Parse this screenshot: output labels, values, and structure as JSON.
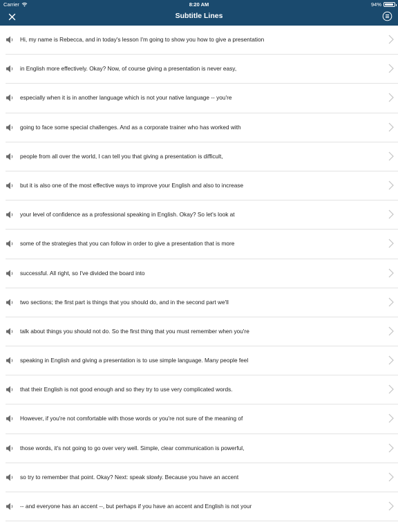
{
  "status_bar": {
    "carrier": "Carrier",
    "time": "8:20 AM",
    "battery": "94%",
    "battery_level": 0.94
  },
  "header": {
    "title": "Subtitle Lines"
  },
  "colors": {
    "header_bg": "#1a4a6e",
    "icon_gray": "#6b6b6b",
    "chevron": "#c4c4c4",
    "divider": "#e3e3e3"
  },
  "icons": {
    "close": "close-icon",
    "menu": "list-menu-icon",
    "speaker": "speaker-icon",
    "chevron": "chevron-right-icon"
  },
  "lines": [
    "Hi, my name is Rebecca, and in today's lesson I'm going to show you how to give a presentation",
    "in English more effectively. Okay? Now, of course giving a presentation is never easy,",
    "especially when it is in another language which is not your native language -- you're",
    "going to face some special challenges. And as a corporate trainer who has worked with",
    "people from all over the world, I can tell you that giving a presentation is difficult,",
    "but it is also one of the most effective ways to improve your English and also to increase",
    "your level of confidence as a professional speaking in English. Okay? So let's look at",
    "some of the strategies that you can follow in order to give a presentation that is more",
    "successful. All right, so I've divided the board into",
    "two sections; the first part is things that you should do, and in the second part we'll",
    "talk about things you should not do. So the first thing that you must remember when you're",
    "speaking in English and giving a presentation is to use simple language. Many people feel",
    "that their English is not good enough and so they try to use very complicated words.",
    "However, if you're not comfortable with those words or you're not sure of the meaning of",
    "those words, it's not going to go over very well. Simple, clear communication is powerful,",
    "so try to remember that point. Okay? Next: speak slowly. Because you have an accent",
    "-- and everyone has an accent --, but perhaps if you have an accent and English is not your"
  ]
}
